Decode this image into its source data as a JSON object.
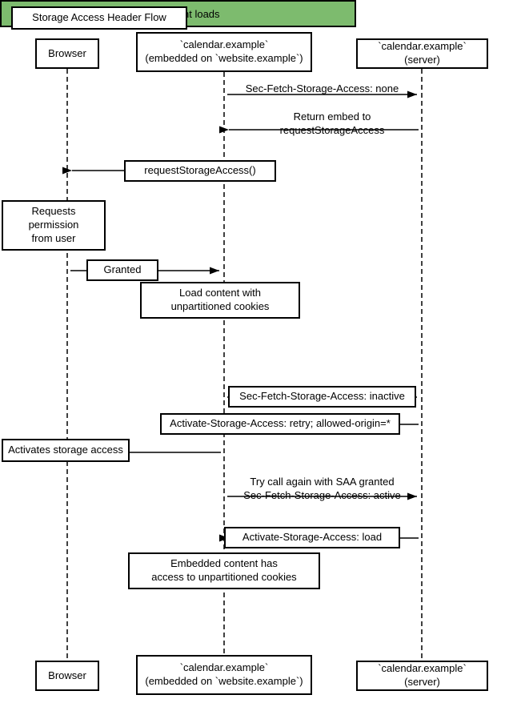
{
  "title": "Storage Access Header Flow",
  "actors": {
    "browser_top_label": "Browser",
    "embed_top_label": "`calendar.example`\n(embedded on `website.example`)",
    "server_top_label": "`calendar.example`\n(server)",
    "browser_bottom_label": "Browser",
    "embed_bottom_label": "`calendar.example`\n(embedded on `website.example`)",
    "server_bottom_label": "`calendar.example`\n(server)"
  },
  "messages": {
    "m1": "Sec-Fetch-Storage-Access: none",
    "m2": "Return embed to\nrequestStorageAccess",
    "m3": "requestStorageAccess()",
    "m4": "Requests permission\nfrom user",
    "m5": "Granted",
    "m6": "Load content with\nunpartitioned cookies",
    "m7": "Subsequent loads",
    "m8": "Sec-Fetch-Storage-Access: inactive",
    "m9": "Activate-Storage-Access: retry; allowed-origin=*",
    "m10": "Activates storage access",
    "m11": "Try call again with SAA granted\nSec-Fetch-Storage-Access: active",
    "m12": "Activate-Storage-Access: load",
    "m13": "Embedded content has\naccess to unpartitioned cookies"
  }
}
